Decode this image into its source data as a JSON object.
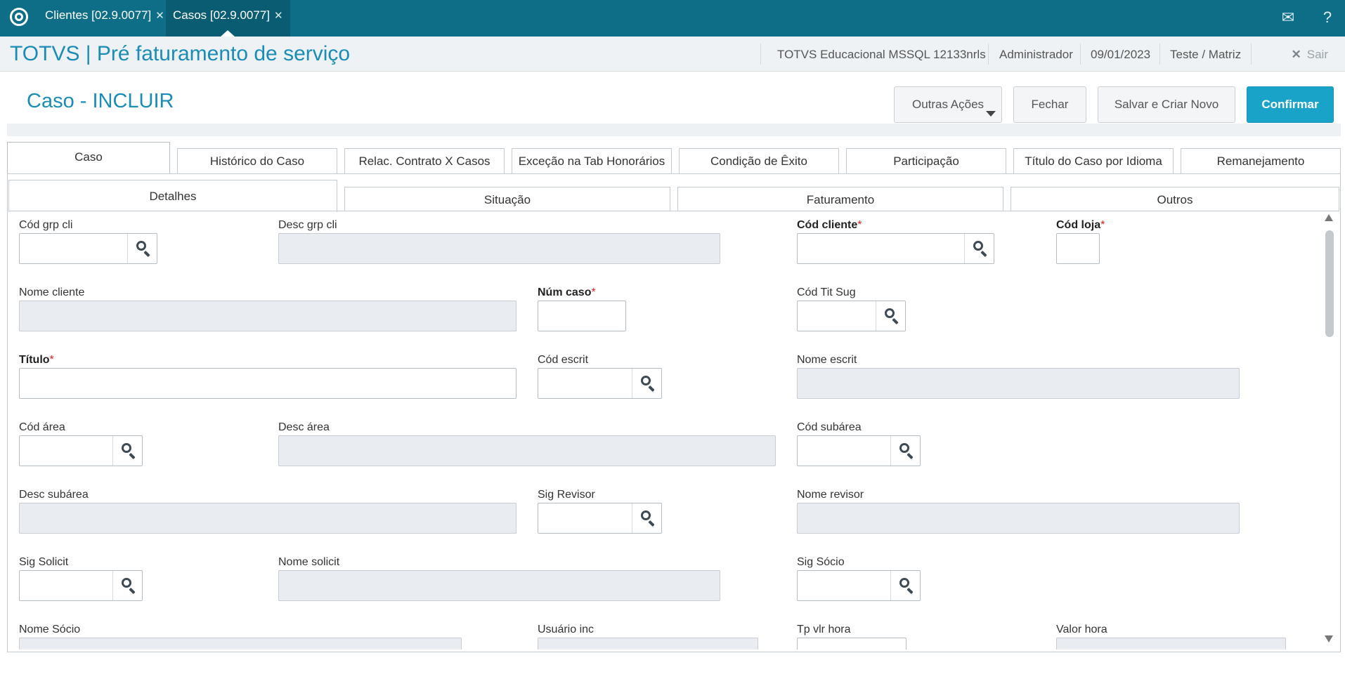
{
  "app_tabs": [
    {
      "label": "Clientes [02.9.0077]"
    },
    {
      "label": "Casos [02.9.0077]"
    }
  ],
  "app_title": "TOTVS | Pré faturamento de serviço",
  "header_info": {
    "environment": "TOTVS Educacional MSSQL 12133nrls",
    "user": "Administrador",
    "date": "09/01/2023",
    "branch": "Teste / Matriz",
    "exit_label": "Sair"
  },
  "form": {
    "title": "Caso - INCLUIR",
    "buttons": {
      "other_actions": "Outras Ações",
      "close": "Fechar",
      "save_new": "Salvar e Criar Novo",
      "confirm": "Confirmar"
    }
  },
  "outer_tabs": [
    {
      "label": "Caso"
    },
    {
      "label": "Histórico do Caso"
    },
    {
      "label": "Relac. Contrato X Casos"
    },
    {
      "label": "Exceção na Tab Honorários"
    },
    {
      "label": "Condição de Êxito"
    },
    {
      "label": "Participação"
    },
    {
      "label": "Título do Caso por Idioma"
    },
    {
      "label": "Remanejamento"
    }
  ],
  "inner_tabs": [
    {
      "label": "Detalhes"
    },
    {
      "label": "Situação"
    },
    {
      "label": "Faturamento"
    },
    {
      "label": "Outros"
    }
  ],
  "fields": {
    "cod_grp_cli": {
      "label": "Cód grp cli",
      "value": ""
    },
    "desc_grp_cli": {
      "label": "Desc grp cli",
      "value": ""
    },
    "cod_cliente": {
      "label": "Cód cliente",
      "value": ""
    },
    "cod_loja": {
      "label": "Cód loja",
      "value": ""
    },
    "nome_cliente": {
      "label": "Nome cliente",
      "value": ""
    },
    "num_caso": {
      "label": "Núm caso",
      "value": ""
    },
    "cod_tit_sug": {
      "label": "Cód Tit Sug",
      "value": ""
    },
    "titulo": {
      "label": "Título",
      "value": ""
    },
    "cod_escrit": {
      "label": "Cód escrit",
      "value": ""
    },
    "nome_escrit": {
      "label": "Nome escrit",
      "value": ""
    },
    "cod_area": {
      "label": "Cód área",
      "value": ""
    },
    "desc_area": {
      "label": "Desc área",
      "value": ""
    },
    "cod_subarea": {
      "label": "Cód subárea",
      "value": ""
    },
    "desc_subarea": {
      "label": "Desc subárea",
      "value": ""
    },
    "sig_revisor": {
      "label": "Sig Revisor",
      "value": ""
    },
    "nome_revisor": {
      "label": "Nome revisor",
      "value": ""
    },
    "sig_solicit": {
      "label": "Sig Solicit",
      "value": ""
    },
    "nome_solicit": {
      "label": "Nome solicit",
      "value": ""
    },
    "sig_socio": {
      "label": "Sig Sócio",
      "value": ""
    },
    "nome_socio": {
      "label": "Nome Sócio",
      "value": ""
    },
    "usuario_inc": {
      "label": "Usuário inc",
      "value": ""
    },
    "tp_vlr_hora": {
      "label": "Tp vlr hora",
      "value": ""
    },
    "valor_hora": {
      "label": "Valor hora",
      "value": ""
    }
  },
  "required_marker": "*"
}
